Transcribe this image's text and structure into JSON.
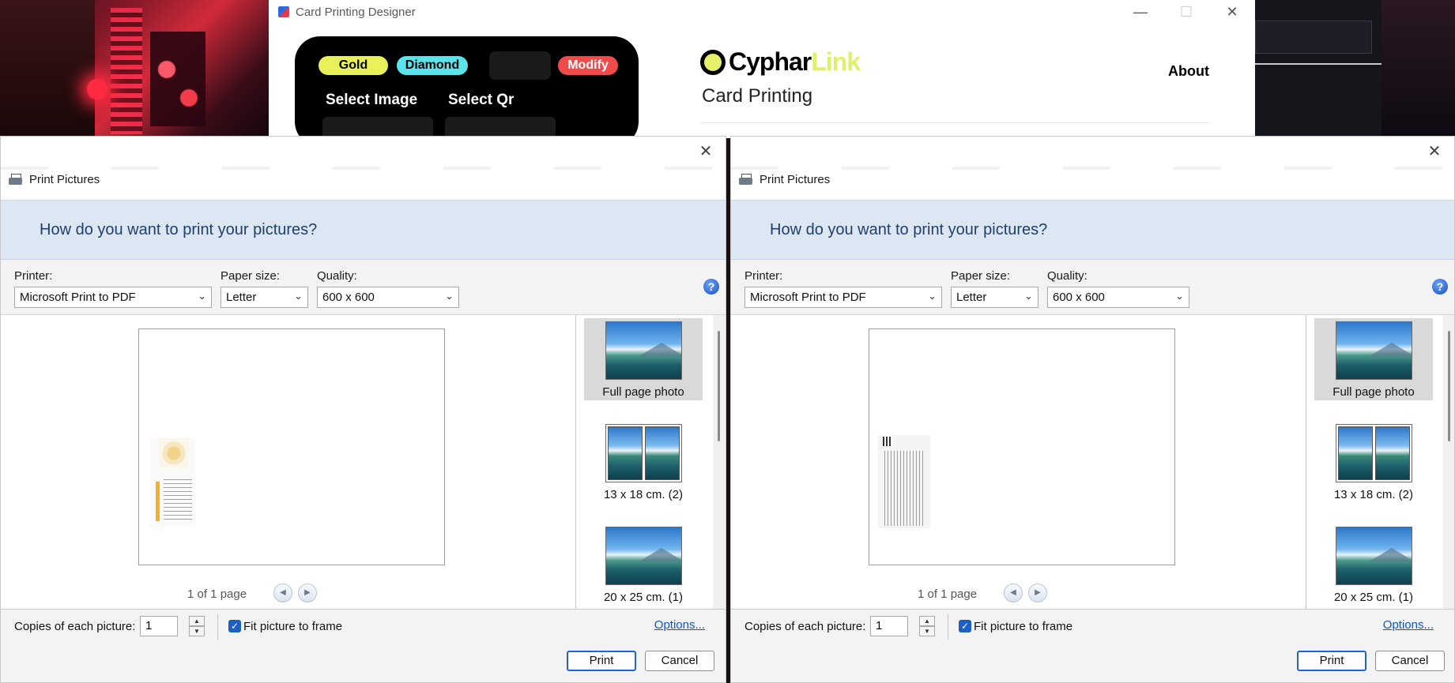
{
  "designer": {
    "title": "Card Printing Designer",
    "pills": {
      "gold": "Gold",
      "diamond": "Diamond",
      "modify": "Modify"
    },
    "select_image": "Select Image",
    "select_qr": "Select Qr",
    "brand": {
      "part1": "Cyphar",
      "part2": "Link"
    },
    "subtitle": "Card Printing",
    "about": "About",
    "window_controls": {
      "minimize": "—",
      "maximize": "☐",
      "close": "✕"
    },
    "colors": {
      "gold": "#e8f05a",
      "diamond": "#5ae3ea",
      "modify": "#ef4b4b",
      "brand_accent": "#dff06a"
    }
  },
  "dialogs": [
    {
      "caption": "Print Pictures",
      "close": "✕",
      "question": "How do you want to print your pictures?",
      "printer_label": "Printer:",
      "printer_value": "Microsoft Print to PDF",
      "paper_label": "Paper size:",
      "paper_value": "Letter",
      "quality_label": "Quality:",
      "quality_value": "600 x 600",
      "help": "?",
      "page_count": "1 of 1 page",
      "layouts": [
        {
          "label": "Full page photo",
          "selected": true
        },
        {
          "label": "13 x 18 cm. (2)",
          "selected": false
        },
        {
          "label": "20 x 25 cm. (1)",
          "selected": false
        }
      ],
      "copies_label": "Copies of each picture:",
      "copies_value": "1",
      "fit_label": "Fit picture to frame",
      "fit_checked": true,
      "options_link": "Options...",
      "print_button": "Print",
      "cancel_button": "Cancel"
    },
    {
      "caption": "Print Pictures",
      "close": "✕",
      "question": "How do you want to print your pictures?",
      "printer_label": "Printer:",
      "printer_value": "Microsoft Print to PDF",
      "paper_label": "Paper size:",
      "paper_value": "Letter",
      "quality_label": "Quality:",
      "quality_value": "600 x 600",
      "help": "?",
      "page_count": "1 of 1 page",
      "layouts": [
        {
          "label": "Full page photo",
          "selected": true
        },
        {
          "label": "13 x 18 cm. (2)",
          "selected": false
        },
        {
          "label": "20 x 25 cm. (1)",
          "selected": false
        }
      ],
      "copies_label": "Copies of each picture:",
      "copies_value": "1",
      "fit_label": "Fit picture to frame",
      "fit_checked": true,
      "options_link": "Options...",
      "print_button": "Print",
      "cancel_button": "Cancel"
    }
  ]
}
